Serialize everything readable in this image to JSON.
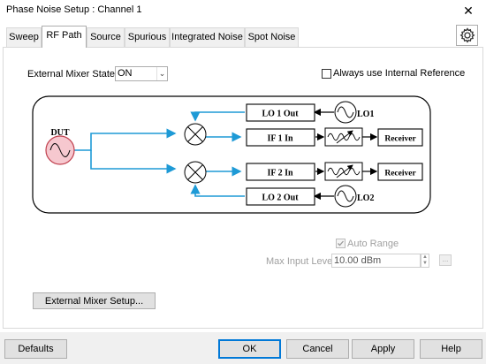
{
  "window": {
    "title": "Phase Noise Setup : Channel 1",
    "close_glyph": "✕"
  },
  "tabs": [
    {
      "label": "Sweep",
      "active": false
    },
    {
      "label": "RF Path",
      "active": true
    },
    {
      "label": "Source",
      "active": false
    },
    {
      "label": "Spurious",
      "active": false
    },
    {
      "label": "Integrated Noise",
      "active": false
    },
    {
      "label": "Spot Noise",
      "active": false
    }
  ],
  "settings_icon": "gear-icon",
  "external_mixer": {
    "label": "External Mixer State",
    "value": "ON",
    "arrow": "⌄"
  },
  "internal_ref": {
    "label": "Always use Internal Reference",
    "checked": false
  },
  "diagram": {
    "dut_label": "DUT",
    "lo1_out": "LO 1 Out",
    "lo1_label": "LO1",
    "if1_in": "IF 1 In",
    "receiver1": "Receiver",
    "if2_in": "IF 2 In",
    "receiver2": "Receiver",
    "lo2_out": "LO 2 Out",
    "lo2_label": "LO2",
    "colors": {
      "signal": "#1e9ad6",
      "box_border": "#000000",
      "dut_fill": "#f6c8cf",
      "dut_border": "#c0404e"
    }
  },
  "auto_range": {
    "label": "Auto Range",
    "checked": true,
    "enabled": false
  },
  "max_input": {
    "label": "Max Input Level",
    "value": "10.00 dBm",
    "more": "..."
  },
  "buttons": {
    "mixer_setup": "External Mixer Setup...",
    "defaults": "Defaults",
    "ok": "OK",
    "cancel": "Cancel",
    "apply": "Apply",
    "help": "Help"
  }
}
